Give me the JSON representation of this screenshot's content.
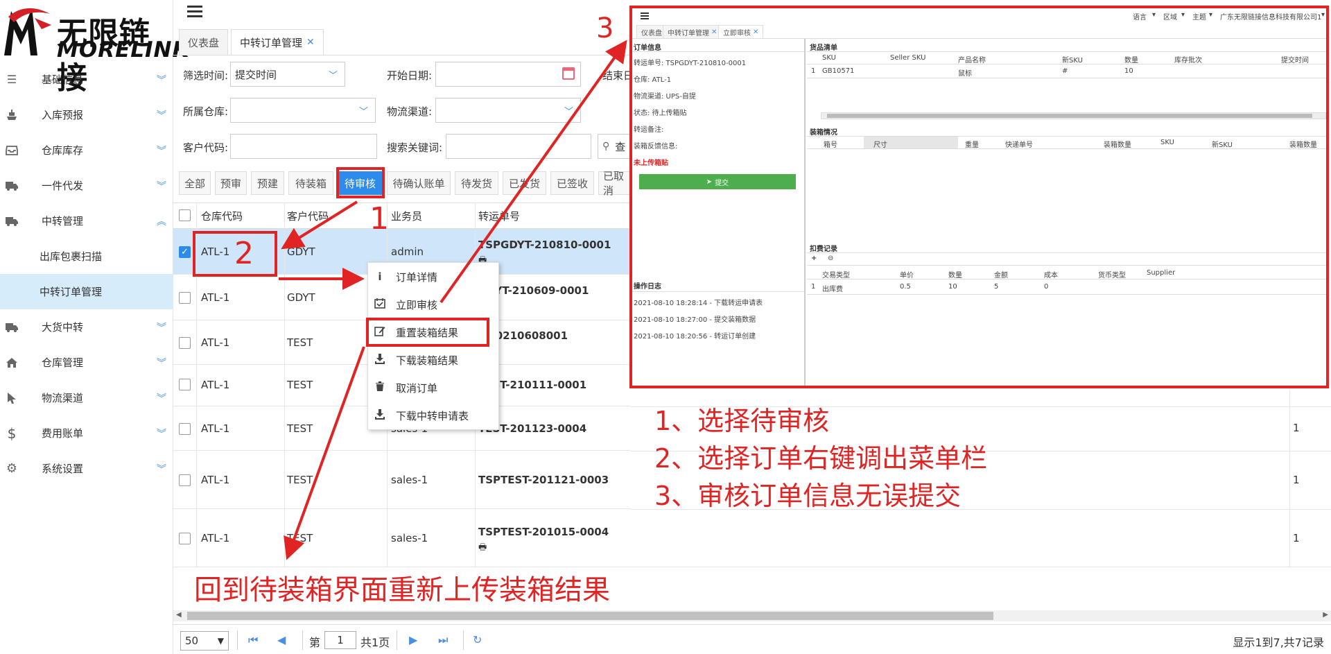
{
  "logo": {
    "cn": "无限链接",
    "en": "MORELINK"
  },
  "sidebar": {
    "items": [
      {
        "label": "基础信息",
        "icon": "list-icon"
      },
      {
        "label": "入库预报",
        "icon": "ship-icon"
      },
      {
        "label": "仓库库存",
        "icon": "inbox-icon"
      },
      {
        "label": "一件代发",
        "icon": "truck-icon"
      },
      {
        "label": "中转管理",
        "icon": "truck-icon",
        "expanded": true
      },
      {
        "label": "大货中转",
        "icon": "truck-icon"
      },
      {
        "label": "仓库管理",
        "icon": "home-icon"
      },
      {
        "label": "物流渠道",
        "icon": "cursor-icon"
      },
      {
        "label": "费用账单",
        "icon": "dollar-icon"
      },
      {
        "label": "系统设置",
        "icon": "gear-icon"
      }
    ],
    "subitems": [
      "出库包裹扫描",
      "中转订单管理"
    ]
  },
  "tabs": [
    "仪表盘",
    "中转订单管理"
  ],
  "filters": {
    "filter_time_label": "筛选时间:",
    "filter_time_value": "提交时间",
    "start_date_label": "开始日期:",
    "end_date_label": "结束日",
    "warehouse_label": "所属仓库:",
    "channel_label": "物流渠道:",
    "customer_label": "客户代码:",
    "keyword_label": "搜索关键词:",
    "search_label": "查"
  },
  "status_buttons": [
    "全部",
    "预审",
    "预建",
    "待装箱",
    "待审核",
    "待确认账单",
    "待发货",
    "已发货",
    "已签收",
    "已取消"
  ],
  "table": {
    "headers": [
      "仓库代码",
      "客户代码",
      "业务员",
      "转运单号"
    ],
    "rows": [
      {
        "warehouse": "ATL-1",
        "customer": "GDYT",
        "sales": "admin",
        "order": "TSPGDYT-210810-0001",
        "right": ""
      },
      {
        "warehouse": "ATL-1",
        "customer": "GDYT",
        "sales": "",
        "order": "GDYT-210609-0001",
        "right": ""
      },
      {
        "warehouse": "ATL-1",
        "customer": "TEST",
        "sales": "",
        "order": "T-20210608001",
        "right": ""
      },
      {
        "warehouse": "ATL-1",
        "customer": "TEST",
        "sales": "",
        "order": "TEST-210111-0001",
        "right": ""
      },
      {
        "warehouse": "ATL-1",
        "customer": "TEST",
        "sales": "sales-1",
        "order": "TEST-201123-0004",
        "right": "1"
      },
      {
        "warehouse": "ATL-1",
        "customer": "TEST",
        "sales": "sales-1",
        "order": "TSPTEST-201121-0003",
        "right": "1"
      },
      {
        "warehouse": "ATL-1",
        "customer": "TEST",
        "sales": "sales-1",
        "order": "TSPTEST-201015-0004",
        "right": "1"
      }
    ]
  },
  "context_menu": [
    {
      "label": "订单详情",
      "icon": "info-icon"
    },
    {
      "label": "立即审核",
      "icon": "calendar-check-icon"
    },
    {
      "label": "重置装箱结果",
      "icon": "edit-icon"
    },
    {
      "label": "下载装箱结果",
      "icon": "download-icon"
    },
    {
      "label": "取消订单",
      "icon": "trash-icon"
    },
    {
      "label": "下载中转申请表",
      "icon": "download-icon"
    }
  ],
  "overlay": {
    "top_right": [
      "语言",
      "区域",
      "主题",
      "广东无限链接信息科技有限公司1"
    ],
    "tabs": [
      "仪表盘",
      "中转订单管理",
      "立即审核"
    ],
    "order_info_title": "订单信息",
    "order_info": [
      "转运单号: TSPGDYT-210810-0001",
      "仓库: ATL-1",
      "物流渠道: UPS-自提",
      "状态: 待上传箱贴",
      "转运备注:",
      "装箱反馈信息:"
    ],
    "warning": "未上传箱贴",
    "submit_label": "提交",
    "log_title": "操作日志",
    "logs": [
      "2021-08-10 18:28:14 - 下载转运申请表",
      "2021-08-10 18:27:00 - 提交装箱数据",
      "2021-08-10 18:20:56 - 转运订单创建"
    ],
    "goods_title": "货品清单",
    "goods_headers": [
      "SKU",
      "Seller SKU",
      "产品名称",
      "新SKU",
      "数量",
      "库存批次",
      "提交时间"
    ],
    "goods_row": {
      "index": "1",
      "sku": "GB10571",
      "name": "鼠标",
      "new_sku": "#",
      "qty": "10"
    },
    "packing_title": "装箱情况",
    "packing_headers": [
      "箱号",
      "尺寸",
      "重量",
      "快递单号",
      "装箱数量",
      "SKU",
      "新SKU",
      "装箱数量"
    ],
    "fee_title": "扣费记录",
    "fee_headers": [
      "交易类型",
      "单价",
      "数量",
      "金额",
      "成本",
      "货币类型",
      "Supplier"
    ],
    "fee_row": {
      "index": "1",
      "type": "出库费",
      "price": "0.5",
      "qty": "10",
      "amount": "5",
      "cost": "0"
    },
    "plus": "+",
    "minus": "⊖"
  },
  "annotations": {
    "n1": "1",
    "n2": "2",
    "n3": "3",
    "steps": [
      "1、选择待审核",
      "2、选择订单右键调出菜单栏",
      "3、审核订单信息无误提交"
    ],
    "bottom": "回到待装箱界面重新上传装箱结果",
    "color": "#e02424"
  },
  "pagination": {
    "page_size": "50",
    "page_prefix": "第",
    "page_value": "1",
    "page_suffix": "共1页",
    "summary": "显示1到7,共7记录"
  }
}
